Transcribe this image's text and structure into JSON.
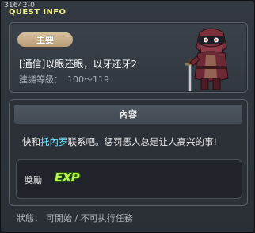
{
  "window": {
    "id": "31642-0",
    "title": "QUEST INFO"
  },
  "quest": {
    "category": "主要",
    "name": "[通信]以眼还眼，以牙还牙2",
    "level_label": "建議等級：",
    "level_range": "100～119"
  },
  "content": {
    "header": "內容",
    "text_before": "快和",
    "npc_name": "托內罗",
    "text_after": "联系吧。惩罚恶人总是让人高兴的事!"
  },
  "reward": {
    "label": "獎勵",
    "item": "EXP"
  },
  "status": {
    "label": "狀態：",
    "value": "可開始 / 不可执行任務"
  },
  "colors": {
    "title": "#f2f28a",
    "npc_highlight": "#6fe4ff",
    "exp": "#b9f54a",
    "badge": "#c8ad88"
  },
  "icons": {
    "npc_portrait": "masked-swordsman-portrait"
  }
}
